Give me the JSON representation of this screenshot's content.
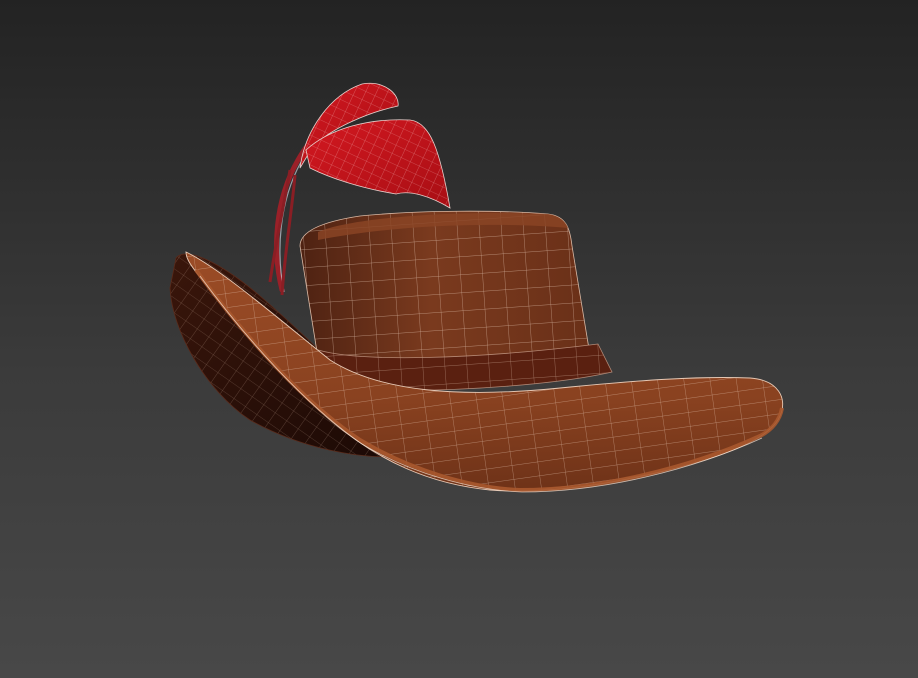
{
  "viewport": {
    "mode": "perspective-3d",
    "shading": "smooth-with-wireframe-edges",
    "background_colors": [
      "#232323",
      "#3b3b3b",
      "#484848"
    ]
  },
  "scene": {
    "object": "hat",
    "parts": [
      {
        "name": "crown",
        "color": "#7a3a1e"
      },
      {
        "name": "crown-top",
        "color": "#8a4424"
      },
      {
        "name": "hat-band",
        "color": "#5a2010"
      },
      {
        "name": "brim",
        "color": "#87411f"
      },
      {
        "name": "brim-underside",
        "color": "#2a0f08"
      },
      {
        "name": "feather",
        "color": "#c8121a"
      },
      {
        "name": "feather-quill",
        "color": "#9a2028"
      }
    ],
    "wireframe_color": "#e6c8b4"
  }
}
